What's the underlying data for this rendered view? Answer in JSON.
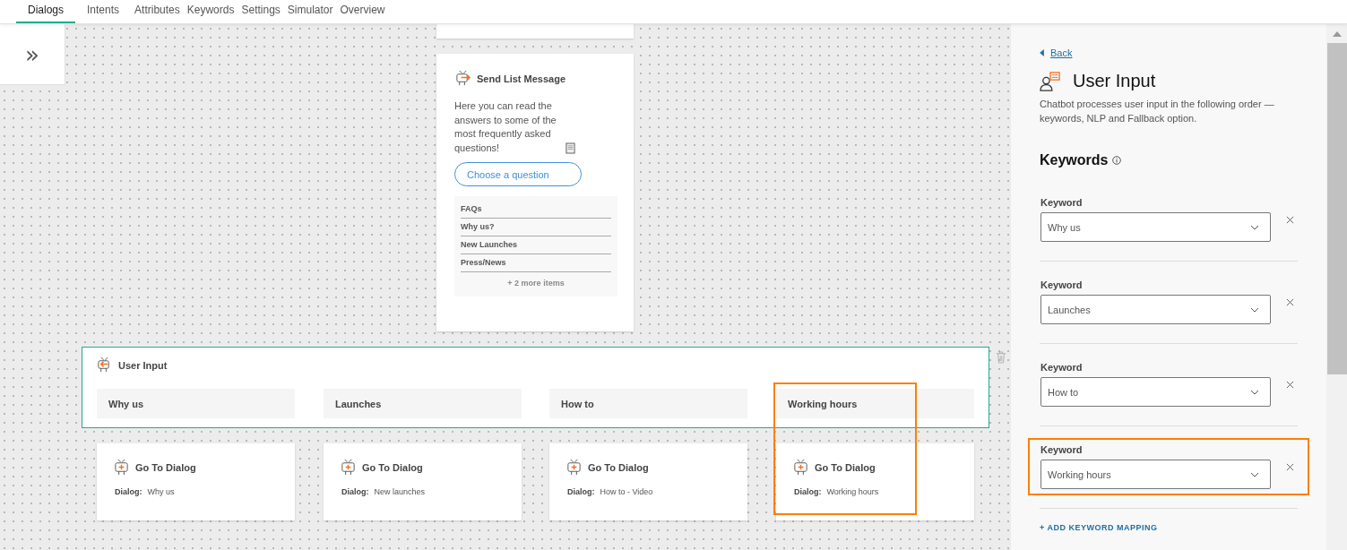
{
  "tabs": [
    {
      "label": "Dialogs",
      "selected": true
    },
    {
      "label": "Intents",
      "selected": false
    },
    {
      "label": "Attributes",
      "selected": false
    },
    {
      "label": "Keywords",
      "selected": false
    },
    {
      "label": "Settings",
      "selected": false
    },
    {
      "label": "Simulator",
      "selected": false
    },
    {
      "label": "Overview",
      "selected": false
    }
  ],
  "sidebar_toggle": {
    "glyph": "»"
  },
  "list_message": {
    "title": "Send List Message",
    "text": "Here you can read the answers to some of the most frequently asked questions!",
    "button": "Choose a question",
    "items": [
      "FAQs",
      "Why us?",
      "New Launches",
      "Press/News"
    ],
    "more": "+ 2 more items"
  },
  "user_input": {
    "title": "User Input",
    "branches": [
      {
        "keyword": "Why us",
        "target_title": "Go To Dialog",
        "dialog_label": "Dialog:",
        "dialog": "Why us",
        "highlighted": false
      },
      {
        "keyword": "Launches",
        "target_title": "Go To Dialog",
        "dialog_label": "Dialog:",
        "dialog": "New launches",
        "highlighted": false
      },
      {
        "keyword": "How to",
        "target_title": "Go To Dialog",
        "dialog_label": "Dialog:",
        "dialog": "How to - Video",
        "highlighted": false
      },
      {
        "keyword": "Working hours",
        "target_title": "Go To Dialog",
        "dialog_label": "Dialog:",
        "dialog": "Working hours",
        "highlighted": true
      }
    ]
  },
  "panel": {
    "back": "Back",
    "title": "User Input",
    "description": "Chatbot processes user input in the following order — keywords, NLP and Fallback option.",
    "section": "Keywords",
    "keywords": [
      {
        "label": "Keyword",
        "value": "Why us",
        "highlighted": false
      },
      {
        "label": "Keyword",
        "value": "Launches",
        "highlighted": false
      },
      {
        "label": "Keyword",
        "value": "How to",
        "highlighted": false
      },
      {
        "label": "Keyword",
        "value": "Working hours",
        "highlighted": true
      }
    ],
    "add": "+ ADD KEYWORD MAPPING"
  }
}
